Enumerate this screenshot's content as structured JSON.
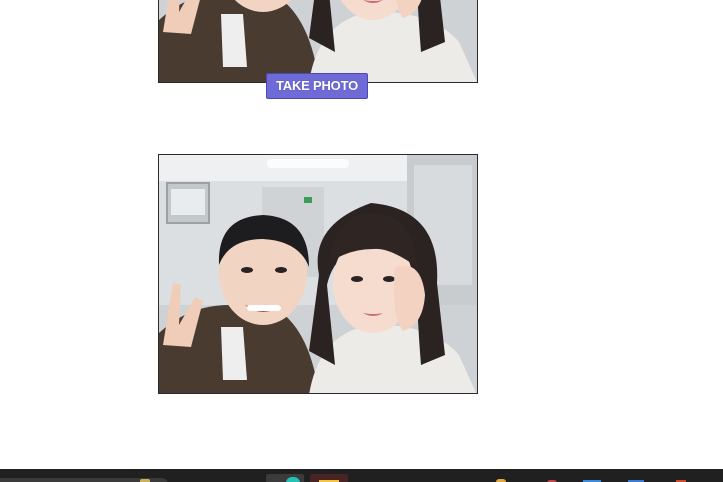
{
  "camera": {
    "take_photo_label": "TAKE PHOTO"
  },
  "icons": {
    "taskbar": [
      "search-icon",
      "app-icon",
      "app-icon",
      "folder-icon",
      "app-icon",
      "app-icon",
      "app-icon",
      "app-icon"
    ]
  },
  "colors": {
    "button_background": "#6e6ad6",
    "frame_border": "#2b2b2b",
    "taskbar_background": "#202020"
  }
}
